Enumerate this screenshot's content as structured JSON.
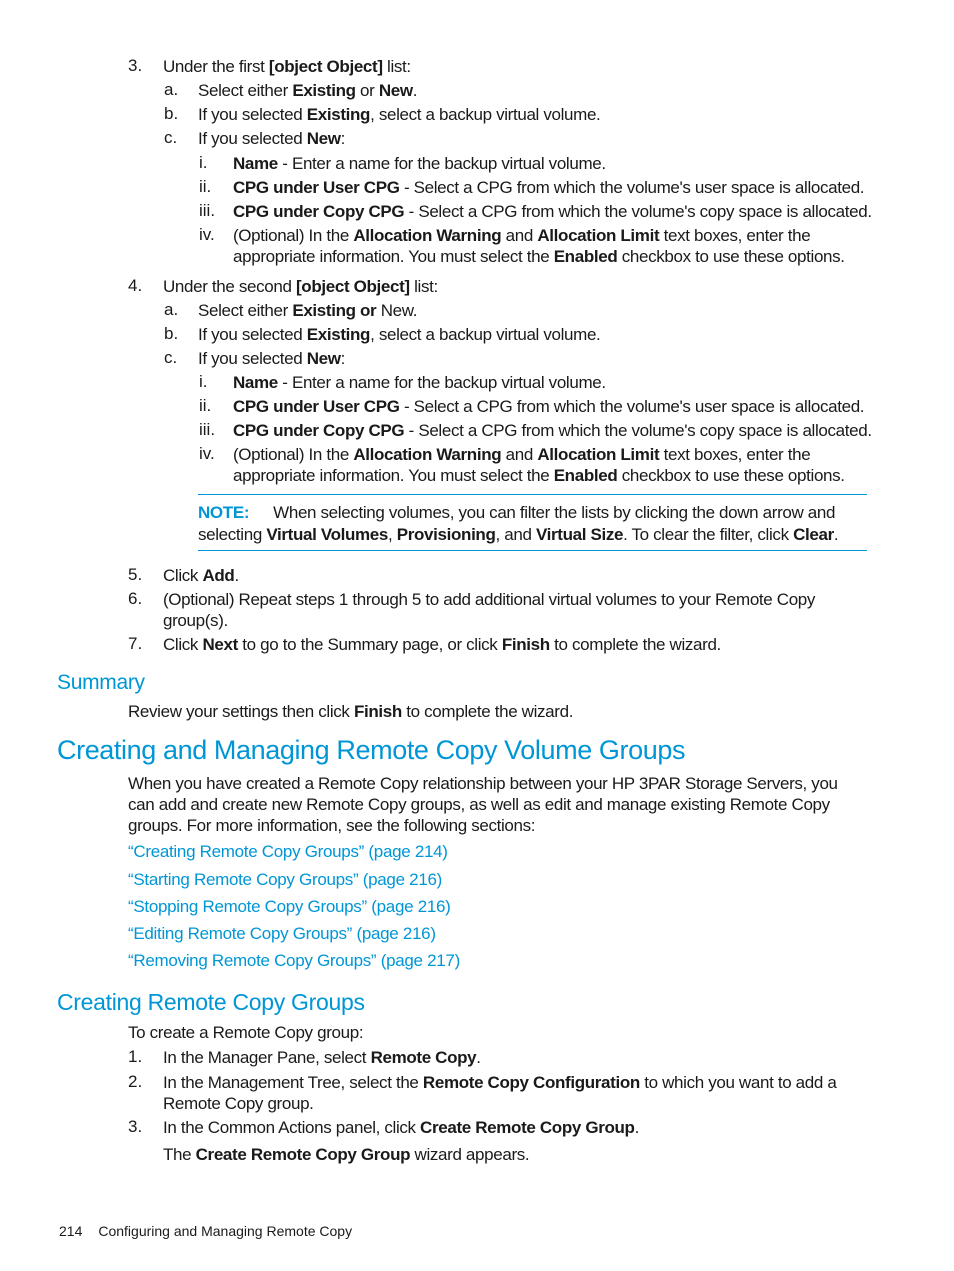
{
  "steps_top": {
    "step3": {
      "num": "3.",
      "pre": "Under the first ",
      "b": {
        "num": "b.",
        "pre": "If you selected ",
        "b1": "Existing",
        "post": ", select a backup virtual volume."
      },
      "post": " list:",
      "a": {
        "num": "a.",
        "pre": "Select either ",
        "b1": "Existing",
        "mid": " or ",
        "b2": "New",
        "post": "."
      },
      "c": {
        "num": "c.",
        "pre": "If you selected ",
        "b1": "New",
        "post": ":"
      },
      "i": {
        "num": "i.",
        "b": "Name",
        "post": " - Enter a name for the backup virtual volume."
      },
      "ii": {
        "num": "ii.",
        "b": "CPG under User CPG",
        "post": " - Select a CPG from which the volume's user space is allocated."
      },
      "iii": {
        "num": "iii.",
        "b": "CPG under Copy CPG",
        "post": " - Select a CPG from which the volume's copy space is allocated."
      },
      "iv": {
        "num": "iv.",
        "pre": "(Optional) In the ",
        "b1": "Allocation Warning",
        "mid": " and ",
        "b2": "Allocation Limit",
        "post": " text boxes, enter the",
        "l2pre": "appropriate information. You must select the ",
        "l2b": "Enabled",
        "l2post": " checkbox to use these options."
      }
    },
    "step4": {
      "num": "4.",
      "pre": "Under the second ",
      "b": {
        "num": "b.",
        "pre": "If you selected ",
        "b1": "Existing",
        "post": ", select a backup virtual volume."
      },
      "post": " list:",
      "a": {
        "num": "a.",
        "pre": "Select either ",
        "b1": "Existing or",
        "post": " New."
      },
      "c": {
        "num": "c.",
        "pre": "If you selected ",
        "b1": "New",
        "post": ":"
      },
      "i": {
        "num": "i.",
        "b": "Name",
        "post": " - Enter a name for the backup virtual volume."
      },
      "ii": {
        "num": "ii.",
        "b": "CPG under User CPG",
        "post": " - Select a CPG from which the volume's user space is allocated."
      },
      "iii": {
        "num": "iii.",
        "b": "CPG under Copy CPG",
        "post": " - Select a CPG from which the volume's copy space is allocated."
      },
      "iv": {
        "num": "iv.",
        "pre": "(Optional) In the ",
        "b1": "Allocation Warning",
        "mid": " and ",
        "b2": "Allocation Limit",
        "post": " text boxes, enter the",
        "l2pre": "appropriate information. You must select the ",
        "l2b": "Enabled",
        "l2post": " checkbox to use these options."
      }
    },
    "note": {
      "label": "NOTE:",
      "l1": "When selecting volumes, you can filter the lists by clicking the down arrow and",
      "l2pre": "selecting ",
      "l2b1": "Virtual Volumes",
      "l2s1": ", ",
      "l2b2": "Provisioning",
      "l2s2": ", and ",
      "l2b3": "Virtual Size",
      "l2s3": ". To clear the filter, click ",
      "l2b4": "Clear",
      "l2post": "."
    },
    "step5": {
      "num": "5.",
      "pre": "Click ",
      "b": "Add",
      "post": "."
    },
    "step6": {
      "num": "6.",
      "l1": "(Optional) Repeat steps 1 through 5 to add additional virtual volumes to your Remote Copy",
      "l2": "group(s)."
    },
    "step7": {
      "num": "7.",
      "pre": "Click ",
      "b1": "Next",
      "mid": " to go to the Summary page, or click ",
      "b2": "Finish",
      "post": " to complete the wizard."
    }
  },
  "summary": {
    "heading": "Summary",
    "pre": "Review your settings then click ",
    "b": "Finish",
    "post": " to complete the wizard."
  },
  "section_main": {
    "heading": "Creating and Managing Remote Copy Volume Groups",
    "p1": "When you have created a Remote Copy relationship between your HP 3PAR Storage Servers, you",
    "p2": "can add and create new Remote Copy groups, as well as edit and manage existing Remote Copy",
    "p3": "groups. For more information, see the following sections:",
    "links": [
      "“Creating Remote Copy Groups” (page 214)",
      "“Starting Remote Copy Groups” (page 216)",
      "“Stopping Remote Copy Groups” (page 216)",
      "“Editing Remote Copy Groups” (page 216)",
      "“Removing Remote Copy Groups” (page 217)"
    ]
  },
  "section_create": {
    "heading": "Creating Remote Copy Groups",
    "intro": "To create a Remote Copy group:",
    "s1": {
      "num": "1.",
      "pre": "In the Manager Pane, select ",
      "b": "Remote Copy",
      "post": "."
    },
    "s2": {
      "num": "2.",
      "pre": "In the Management Tree, select the ",
      "b": "Remote Copy Configuration",
      "post": " to which you want to add a",
      "l2": "Remote Copy group."
    },
    "s3": {
      "num": "3.",
      "pre": "In the Common Actions panel, click ",
      "b": "Create Remote Copy Group",
      "post": "."
    },
    "result": {
      "pre": "The ",
      "b": "Create Remote Copy Group",
      "post": " wizard appears."
    }
  },
  "footer": {
    "page": "214",
    "title": "Configuring and Managing Remote Copy"
  }
}
